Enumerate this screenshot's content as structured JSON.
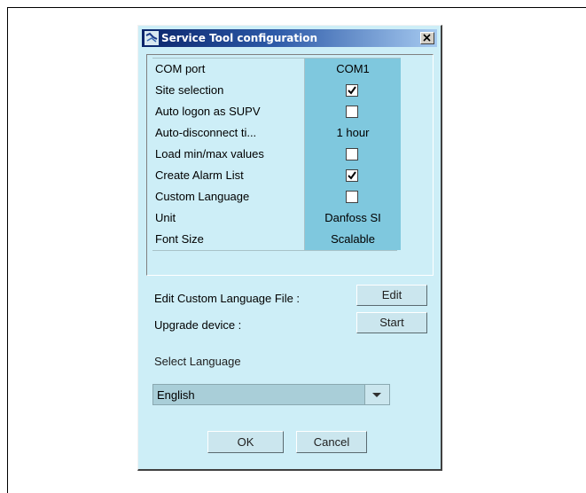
{
  "dialog": {
    "title": "Service Tool configuration",
    "close_label": "×"
  },
  "settings": [
    {
      "label": "COM port",
      "type": "text",
      "value": "COM1"
    },
    {
      "label": "Site selection",
      "type": "checkbox",
      "checked": true
    },
    {
      "label": "Auto logon as SUPV",
      "type": "checkbox",
      "checked": false
    },
    {
      "label": "Auto-disconnect ti...",
      "type": "text",
      "value": "1 hour"
    },
    {
      "label": "Load min/max values",
      "type": "checkbox",
      "checked": false
    },
    {
      "label": "Create Alarm List",
      "type": "checkbox",
      "checked": true
    },
    {
      "label": "Custom Language",
      "type": "checkbox",
      "checked": false
    },
    {
      "label": "Unit",
      "type": "text",
      "value": "Danfoss SI"
    },
    {
      "label": "Font Size",
      "type": "text",
      "value": "Scalable"
    }
  ],
  "actions": {
    "edit_custom_language_label": "Edit Custom Language File :",
    "edit_button": "Edit",
    "upgrade_device_label": "Upgrade device :",
    "start_button": "Start"
  },
  "language": {
    "label": "Select Language",
    "selected": "English"
  },
  "footer": {
    "ok_button": "OK",
    "cancel_button": "Cancel"
  }
}
